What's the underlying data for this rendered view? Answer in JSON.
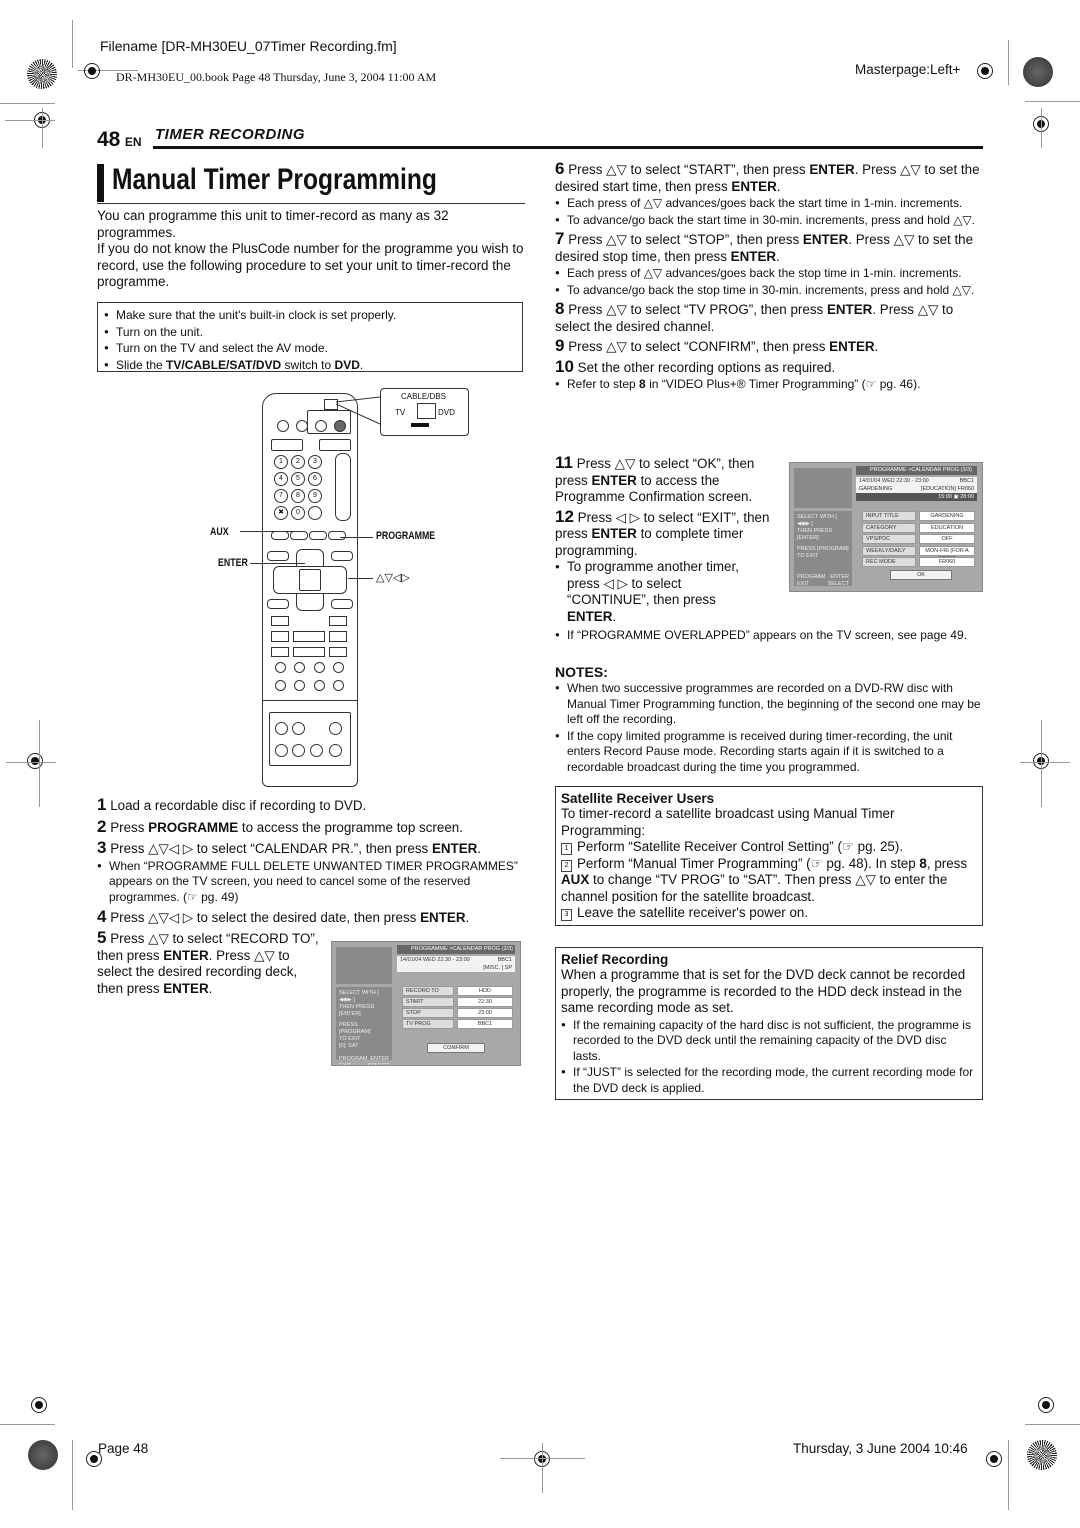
{
  "header": {
    "filename": "Filename [DR-MH30EU_07Timer Recording.fm]",
    "book_line": "DR-MH30EU_00.book  Page 48  Thursday, June 3, 2004  11:00 AM",
    "masterpage": "Masterpage:Left+"
  },
  "page": {
    "number": "48",
    "lang": "EN",
    "section": "TIMER RECORDING",
    "title": "Manual Timer Programming"
  },
  "intro": {
    "p1": "You can programme this unit to timer-record as many as 32 programmes.",
    "p2": "If you do not know the PlusCode number for the programme you wish to record, use the following procedure to set your unit to timer-record the programme."
  },
  "prep_box": {
    "items": [
      "Make sure that the unit's built-in clock is set properly.",
      "Turn on the unit.",
      "Turn on the TV and select the AV mode."
    ],
    "item4_pre": "Slide the ",
    "item4_bold": "TV/CABLE/SAT/DVD",
    "item4_mid": " switch to ",
    "item4_bold2": "DVD",
    "item4_post": "."
  },
  "remote": {
    "switch_label": "CABLE/DBS",
    "switch_tv": "TV",
    "switch_dvd": "DVD",
    "callout_aux": "AUX",
    "callout_enter": "ENTER",
    "callout_programme": "PROGRAMME",
    "callout_arrows": "△▽◁▷",
    "numpad": [
      "1",
      "2",
      "3",
      "4",
      "5",
      "6",
      "7",
      "8",
      "9",
      "✖",
      "0",
      ""
    ]
  },
  "steps_left": [
    {
      "num": "1",
      "text": "Load a recordable disc if recording to DVD."
    },
    {
      "num": "2",
      "pre": "Press ",
      "bold": "PROGRAMME",
      "post": " to access the programme top screen."
    },
    {
      "num": "3",
      "pre": "Press △▽◁ ▷ to select “CALENDAR PR.”, then press ",
      "bold": "ENTER",
      "post": "."
    },
    {
      "num": "4",
      "pre": "Press △▽◁ ▷ to select the desired date, then press ",
      "bold": "ENTER",
      "post": "."
    }
  ],
  "step3_note": "When “PROGRAMME FULL DELETE UNWANTED TIMER PROGRAMMES” appears on the TV screen, you need to cancel some of the reserved programmes. (☞ pg. 49)",
  "step5": {
    "num": "5",
    "pre": "Press △▽ to select “RECORD TO”, then press ",
    "bold1": "ENTER",
    "mid": ". Press △▽ to select the desired recording deck, then press ",
    "bold2": "ENTER",
    "post": "."
  },
  "screen1": {
    "title": "PROGRAMME >CALENDAR PROG  (2/3)",
    "info_line1_left": "14/01/04 WED  22:30 - 23:00",
    "info_line1_right": "BBC1",
    "info_line2_right": "[MISC. ]  SP",
    "help1": "SELECT WITH [ ◀◆▶ ]",
    "help2": "THEN PRESS [ENTER]",
    "help3": "PRESS [PROGRAM]",
    "help4": "TO EXIT",
    "help5": "[0]: SAT",
    "nav_program": "PROGRAM",
    "nav_enter": "ENTER",
    "nav_exit": "EXIT",
    "nav_select": "SELECT",
    "rows": [
      {
        "label": "RECORD TO",
        "value": "HDD"
      },
      {
        "label": "START",
        "value": "22:30"
      },
      {
        "label": "STOP",
        "value": "23:00"
      },
      {
        "label": "TV PROG",
        "value": "BBC1"
      }
    ],
    "button": "CONFIRM"
  },
  "steps_right": {
    "s6": {
      "num": "6",
      "pre": "Press △▽ to select “START”, then press ",
      "bold1": "ENTER",
      "mid": ". Press △▽ to set the desired start time, then press ",
      "bold2": "ENTER",
      "post": "."
    },
    "s6_notes": [
      "Each press of △▽ advances/goes back the start time in 1-min. increments.",
      "To advance/go back the start time in 30-min. increments, press and hold △▽."
    ],
    "s7": {
      "num": "7",
      "pre": "Press △▽ to select “STOP”, then press ",
      "bold1": "ENTER",
      "mid": ". Press △▽ to set the desired stop time, then press ",
      "bold2": "ENTER",
      "post": "."
    },
    "s7_notes": [
      "Each press of △▽ advances/goes back the stop time in 1-min. increments.",
      "To advance/go back the stop time in 30-min. increments, press and hold △▽."
    ],
    "s8": {
      "num": "8",
      "pre": "Press △▽ to select “TV PROG”, then press ",
      "bold": "ENTER",
      "post": ". Press △▽ to select the desired channel."
    },
    "s9": {
      "num": "9",
      "pre": "Press △▽ to select “CONFIRM”, then press ",
      "bold": "ENTER",
      "post": "."
    },
    "s10": {
      "num": "10",
      "text": "Set the other recording options as required."
    },
    "s10_note_pre": "Refer to step ",
    "s10_note_bold": "8",
    "s10_note_post": " in “VIDEO Plus+® Timer Programming” (☞ pg. 46).",
    "s11": {
      "num": "11",
      "pre": "Press △▽ to select “OK”, then press ",
      "bold": "ENTER",
      "post": " to access the Programme Confirmation screen."
    },
    "s12": {
      "num": "12",
      "pre": "Press ◁ ▷ to select “EXIT”, then press ",
      "bold": "ENTER",
      "post": " to complete timer programming."
    },
    "s12_note_pre": "To programme another timer, press ◁ ▷ to select “CONTINUE”, then press ",
    "s12_note_bold": "ENTER",
    "s12_note_post": ".",
    "overlap_note": "If “PROGRAMME OVERLAPPED” appears on the TV screen, see page 49."
  },
  "screen2": {
    "title": "PROGRAMME >CALENDAR PROG  (3/3)",
    "info_line1_left": "14/01/04 WED  22:30 - 23:00",
    "info_line1_right": "BBC1",
    "info_line2_left": "GARDENING",
    "info_line2_right": "[EDUCATION]  FR060",
    "info_line3": "15:00  ▣ 28:00",
    "help1": "SELECT WITH [ ◀◆▶ ]",
    "help2": "THEN PRESS [ENTER]",
    "help3": "PRESS [PROGRAM]",
    "help4": "TO EXIT",
    "nav_program": "PROGRAM",
    "nav_enter": "ENTER",
    "nav_exit": "EXIT",
    "nav_select": "SELECT",
    "rows": [
      {
        "label": "INPUT TITLE",
        "value": "GARDENING"
      },
      {
        "label": "CATEGORY",
        "value": "EDUCATION"
      },
      {
        "label": "VPS/PDC",
        "value": "OFF"
      },
      {
        "label": "WEEKLY/DAILY",
        "value": "MON-FRI (FOR A WEEK)"
      },
      {
        "label": "REC MODE",
        "value": "FR060"
      }
    ],
    "button": "OK"
  },
  "notes": {
    "heading": "NOTES:",
    "items": [
      "When two successive programmes are recorded on a DVD-RW disc with Manual Timer Programming function, the beginning of the second one may be left off the recording.",
      "If the copy limited programme is received during timer-recording, the unit enters Record Pause mode. Recording starts again if it is switched to a recordable broadcast during the time you programmed."
    ]
  },
  "satellite": {
    "heading": "Satellite Receiver Users",
    "intro": "To timer-record a satellite broadcast using Manual Timer Programming:",
    "item1": "Perform “Satellite Receiver Control Setting” (☞ pg. 25).",
    "item2_pre": "Perform “Manual Timer Programming” (☞ pg. 48). In step ",
    "item2_bold1": "8",
    "item2_mid1": ", press ",
    "item2_bold2": "AUX",
    "item2_post": " to change “TV PROG” to “SAT”. Then press △▽ to enter the channel position for the satellite broadcast.",
    "item3": "Leave the satellite receiver's power on."
  },
  "relief": {
    "heading": "Relief Recording",
    "intro": "When a programme that is set for the DVD deck cannot be recorded properly, the programme is recorded to the HDD deck instead in the same recording mode as set.",
    "items": [
      "If the remaining capacity of the hard disc is not sufficient, the programme is recorded to the DVD deck until the remaining capacity of the DVD disc lasts.",
      "If “JUST” is selected for the recording mode, the current recording mode for the DVD deck is applied."
    ]
  },
  "footer": {
    "page": "Page 48",
    "date": "Thursday, 3 June 2004  10:46"
  }
}
